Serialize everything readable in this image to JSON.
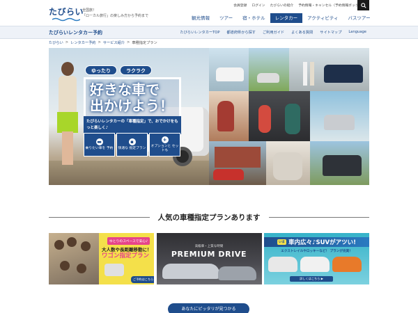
{
  "header": {
    "logo": "たびらい",
    "tagline_line1": "全国旅！",
    "tagline_line2": "「ローカル旅行」の楽しみ方から予約まで",
    "utility_links": [
      "会員登録",
      "ログイン",
      "たびらいの紹介",
      "予約情報・キャンセル（予約情報ボックス）"
    ],
    "nav": [
      {
        "label": "観光情報"
      },
      {
        "label": "ツアー"
      },
      {
        "label": "宿・ホテル"
      },
      {
        "label": "レンタカー"
      },
      {
        "label": "アクティビティ"
      },
      {
        "label": "バスツアー"
      }
    ],
    "active_nav": "レンタカー"
  },
  "subheader": {
    "title": "たびらいレンタカー予約",
    "links": [
      "たびらいレンタカーTOP",
      "都道府県から探す",
      "ご利用ガイド",
      "よくある質問",
      "サイトマップ",
      "Language"
    ]
  },
  "breadcrumb": {
    "items": [
      "たびらい",
      "レンタカー予約",
      "サービス紹介",
      "車種指定プラン"
    ],
    "separator": ">"
  },
  "hero": {
    "badge_left": "ゆったり",
    "badge_right": "ラクラク",
    "headline_line1": "好きな車で",
    "headline_line2": "出かけよう！",
    "description": "たびらいレンタカーの「車種指定」で、おでかけをもっと楽しく♪",
    "features": [
      {
        "icon": "car-icon",
        "label": "乗りたい車を 予約"
      },
      {
        "icon": "seat-icon",
        "label": "快適な 指定プラン"
      },
      {
        "icon": "plus-icon",
        "label": "オプションと セットも"
      }
    ]
  },
  "section": {
    "title": "人気の車種指定プランあります"
  },
  "cards": {
    "card1": {
      "tag": "ゆとりのスペースで安心♪",
      "line1": "大人数や長距離移動に！",
      "line2": "ワゴン指定プラン",
      "button": "ご予約はこちら ▶"
    },
    "card2": {
      "small": "高級車・上質な時間",
      "big": "PREMIUM DRIVE"
    },
    "card3": {
      "tag": "いま",
      "head": "車内広々♪SUVがアツい!",
      "sub": "エクストレイルやロッキーなど！ プランが充実！",
      "button": "詳しくはこちら ▶"
    }
  },
  "cta": {
    "label": "あなたにピッタリが見つかる"
  },
  "colors": {
    "brand": "#1f4d8c",
    "wagon_yellow": "#f4e04a",
    "accent_pink": "#e6448a"
  }
}
